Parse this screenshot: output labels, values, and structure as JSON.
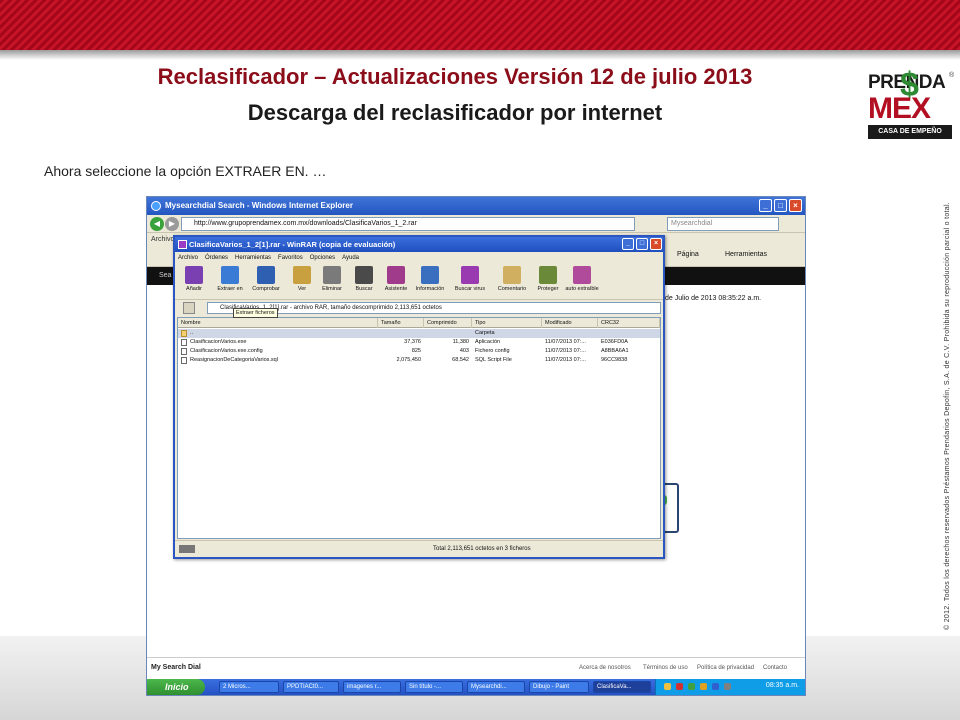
{
  "slide": {
    "title": "Reclasificador – Actualizaciones Versión 12 de julio 2013",
    "subtitle": "Descarga del reclasificador por internet",
    "instruction": "Ahora seleccione la opción EXTRAER EN. …",
    "copyright": "© 2012. Todos los derechos reservados Préstamos Prendarios Depofin, S.A. de C.V. Prohibida su reproducción parcial o total."
  },
  "logo": {
    "top": "PRENDA",
    "mex": "MEX",
    "reg": "®",
    "bar": "CASA DE EMPEÑO",
    "dollar": "$"
  },
  "ie": {
    "title": "Mysearchdial Search - Windows Internet Explorer",
    "address": "http://www.grupoprendamex.com.mx/downloads/ClasificaVarios_1_2.rar",
    "search_placeholder": "Mysearchdial",
    "menu": "Archivo",
    "tools": {
      "page": "Página",
      "herramientas": "Herramientas"
    },
    "dark_bar": "Sea",
    "date_text": "de Julio de 2013 08:35:22 a.m.",
    "footer": {
      "logo": "My Search Dial",
      "links": [
        "Acerca de nosotros",
        "Términos de uso",
        "Política de privacidad",
        "Contacto"
      ]
    }
  },
  "rar": {
    "title": "ClasificaVarios_1_2[1].rar - WinRAR (copia de evaluación)",
    "menu": [
      "Archivo",
      "Órdenes",
      "Herramientas",
      "Favoritos",
      "Opciones",
      "Ayuda"
    ],
    "toolbar": [
      {
        "label": "Añadir",
        "color": "#7a3fb0"
      },
      {
        "label": "Extraer en",
        "color": "#3a7bd5"
      },
      {
        "label": "Comprobar",
        "color": "#2f5fb0"
      },
      {
        "label": "Ver",
        "color": "#c9a040"
      },
      {
        "label": "Eliminar",
        "color": "#7a7a7a"
      },
      {
        "label": "Buscar",
        "color": "#4a4a4a"
      },
      {
        "label": "Asistente",
        "color": "#a03a8a"
      },
      {
        "label": "Información",
        "color": "#3a6fc0"
      },
      {
        "label": "Buscar virus",
        "color": "#9a3ab0"
      },
      {
        "label": "Comentario",
        "color": "#d0b060"
      },
      {
        "label": "Proteger",
        "color": "#6a8a3a"
      },
      {
        "label": "auto extraíble",
        "color": "#b04a9a"
      }
    ],
    "path": "ClasificaVarios_1_2[1].rar - archivo RAR, tamaño descomprimido 2,113,651 octetos",
    "tooltip": "Extraer ficheros",
    "columns": [
      "Nombre",
      "Tamaño",
      "Comprimido",
      "Tipo",
      "Modificado",
      "CRC32"
    ],
    "rows": [
      {
        "name": "..",
        "size": "",
        "packed": "",
        "type": "Carpeta",
        "modified": "",
        "crc": "",
        "folder": true
      },
      {
        "name": "ClasificacionVarios.exe",
        "size": "37,376",
        "packed": "11,380",
        "type": "Aplicación",
        "modified": "11/07/2013 07:...",
        "crc": "E036FD0A"
      },
      {
        "name": "ClasificacionVarios.exe.config",
        "size": "825",
        "packed": "403",
        "type": "Fichero config",
        "modified": "11/07/2013 07:...",
        "crc": "A8BBA6A1"
      },
      {
        "name": "ReasignacionDeCategoriaVarios.sql",
        "size": "2,075,450",
        "packed": "68,542",
        "type": "SQL Script File",
        "modified": "11/07/2013 07:...",
        "crc": "96CC9838"
      }
    ],
    "status": "Total 2,113,651 octetos en 3 ficheros"
  },
  "taskbar": {
    "start": "Inicio",
    "items": [
      "2 Micros...",
      "PPDTIACt0...",
      "imagenes r...",
      "Sin título -...",
      "Mysearchdi...",
      "Dibujo - Paint",
      "ClasificaVa..."
    ],
    "active_index": 6,
    "clock": "08:35 a.m."
  },
  "colors": {
    "accent": "#8b0d19",
    "banner": "#c81328",
    "logo_green": "#2e8b34"
  }
}
